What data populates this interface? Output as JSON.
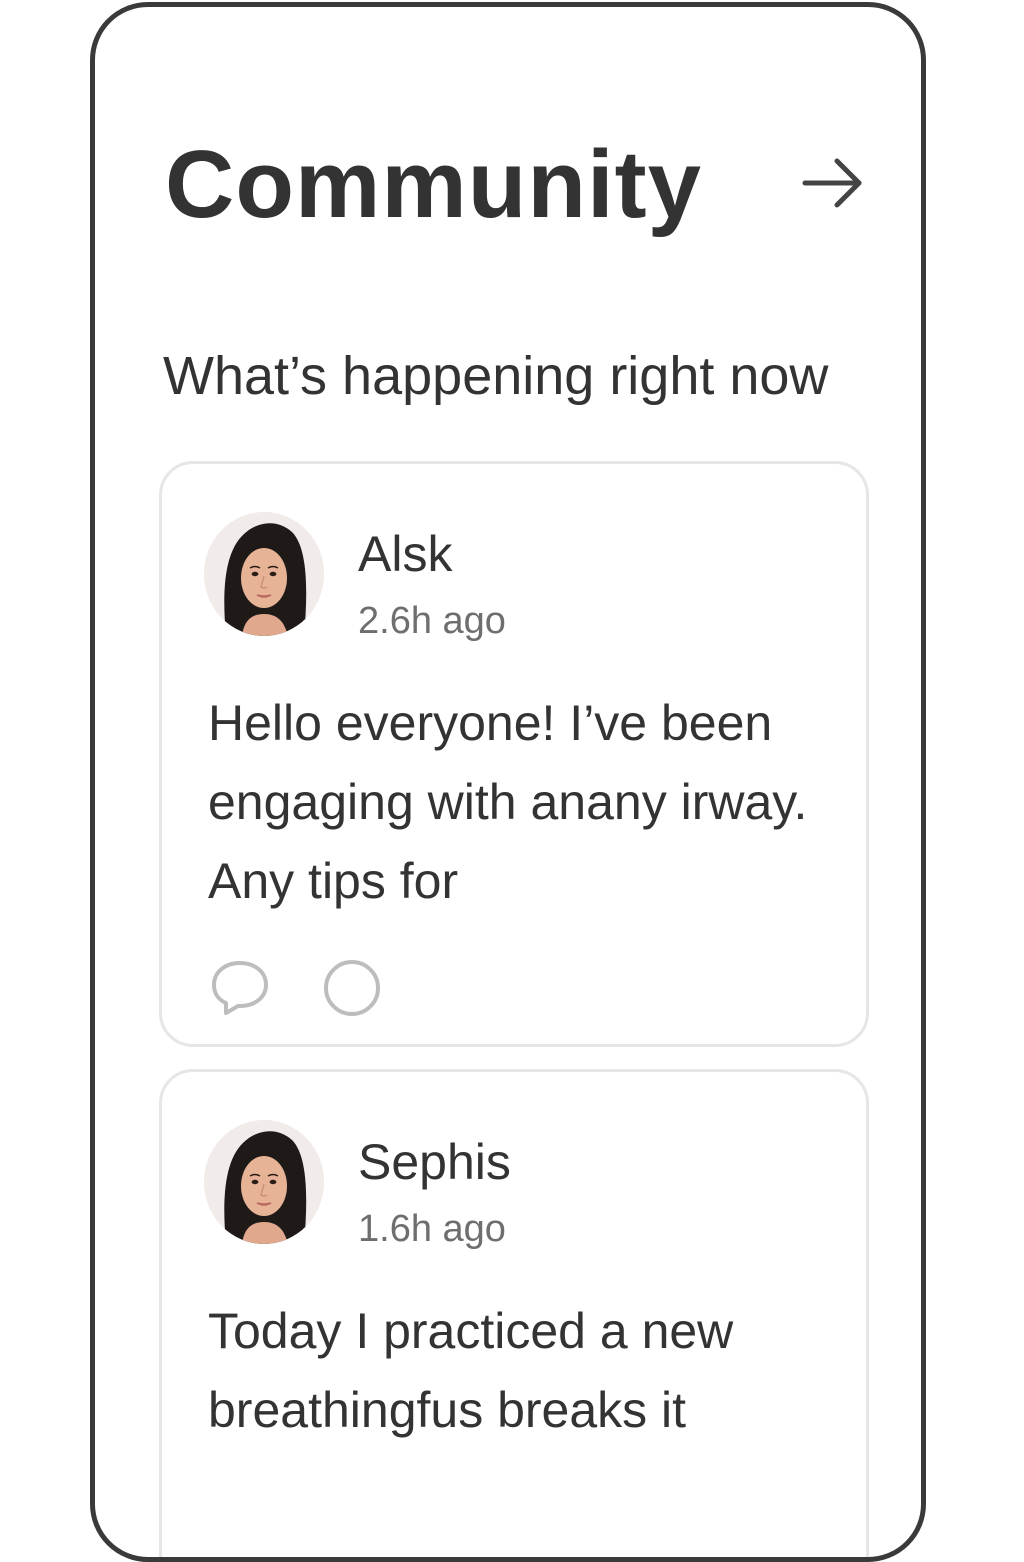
{
  "header": {
    "title": "Community",
    "arrow_icon": "arrow-right-icon"
  },
  "section": {
    "heading": "What’s happening right now"
  },
  "posts": [
    {
      "author": "Alsk",
      "time": "2.6h ago",
      "body": "Hello everyone! I’ve been engaging with anany irway. Any tips for",
      "avatar_icon": "user-avatar",
      "actions": [
        "comment-icon",
        "circle-icon"
      ]
    },
    {
      "author": "Sephis",
      "time": "1.6h ago",
      "body": "Today I practiced a new breathingfus breaks it",
      "avatar_icon": "user-avatar"
    }
  ],
  "colors": {
    "text": "#333333",
    "muted": "#6e6e6e",
    "border": "#e6e6e6",
    "frame": "#3a3a3a",
    "icon_muted": "#bdbdbd"
  }
}
